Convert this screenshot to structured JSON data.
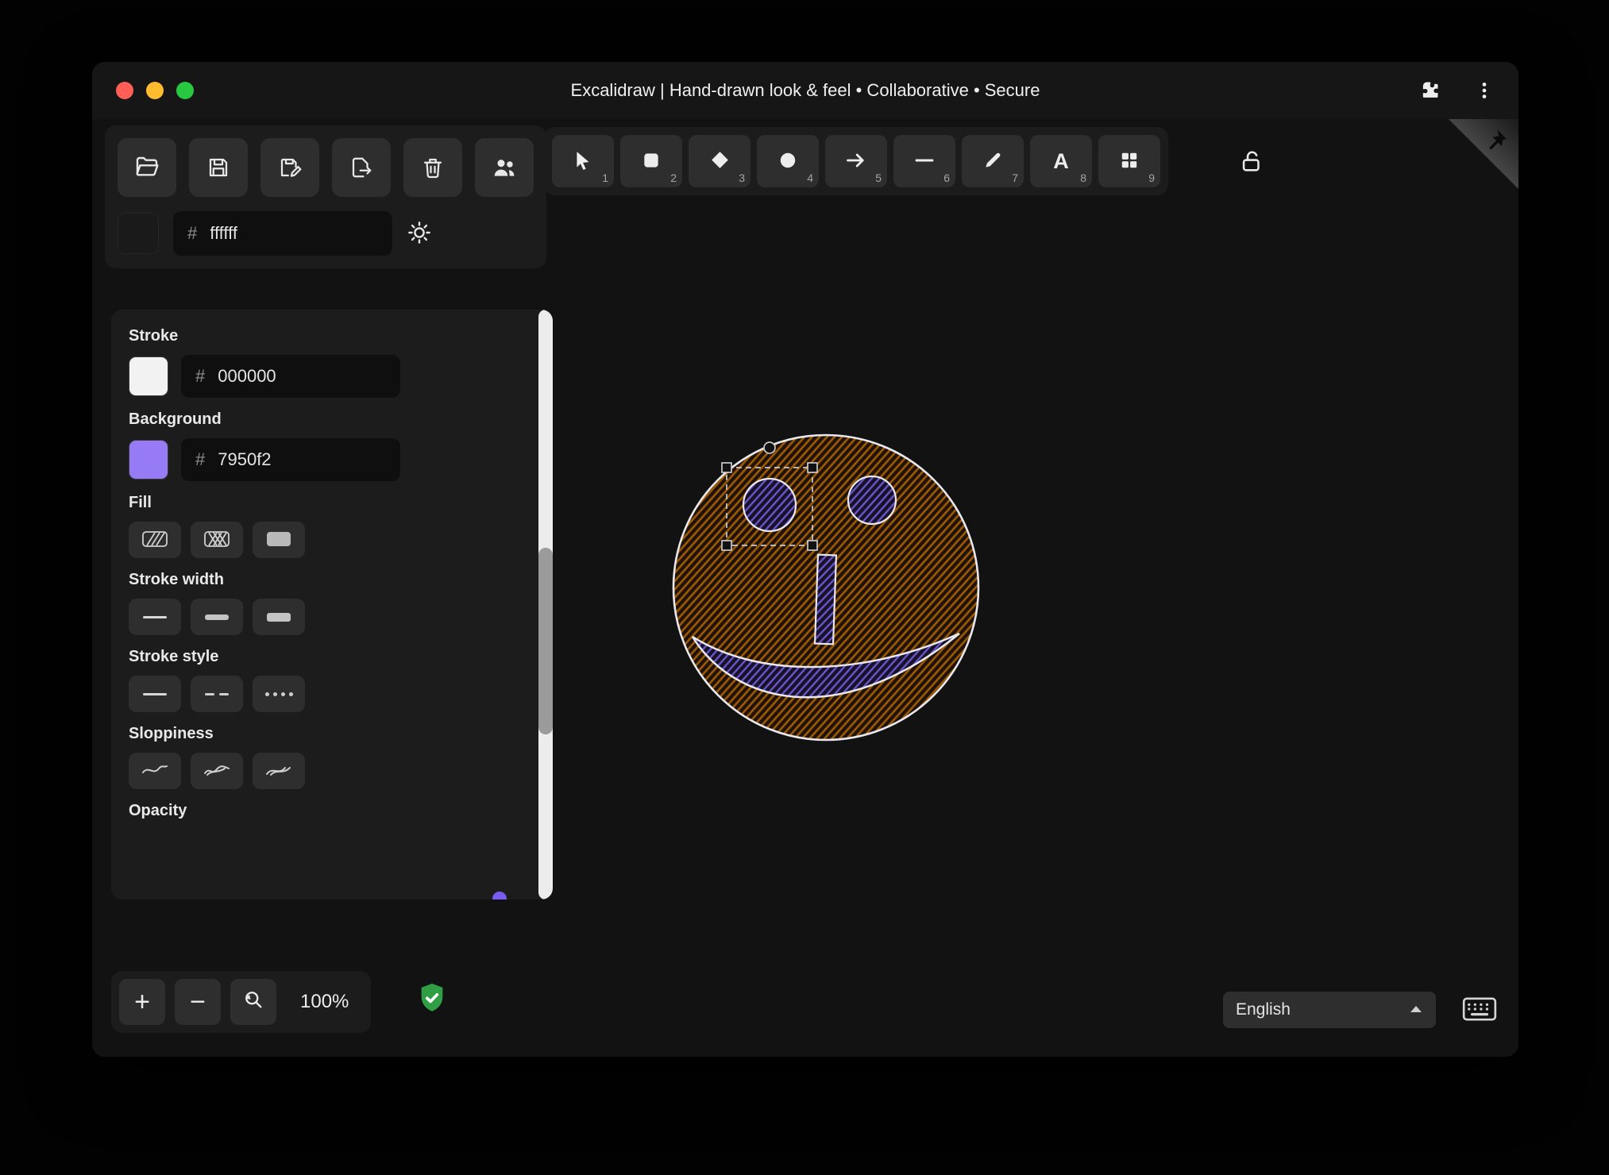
{
  "titlebar": {
    "title": "Excalidraw | Hand-drawn look & feel • Collaborative • Secure"
  },
  "file_toolbar": {
    "buttons": [
      "open-folder",
      "save",
      "save-as",
      "export-file",
      "trash",
      "collaborators"
    ]
  },
  "canvas_background": {
    "hash": "#",
    "value": "ffffff"
  },
  "tool_toolbar": {
    "tools": [
      {
        "name": "selection",
        "shortcut": "1"
      },
      {
        "name": "rectangle",
        "shortcut": "2"
      },
      {
        "name": "diamond",
        "shortcut": "3"
      },
      {
        "name": "ellipse",
        "shortcut": "4"
      },
      {
        "name": "arrow",
        "shortcut": "5"
      },
      {
        "name": "line",
        "shortcut": "6"
      },
      {
        "name": "draw",
        "shortcut": "7"
      },
      {
        "name": "text",
        "shortcut": "8",
        "glyph": "A"
      },
      {
        "name": "shapes",
        "shortcut": "9"
      }
    ],
    "lock": "keep-selected-tool-active"
  },
  "properties_panel": {
    "stroke": {
      "label": "Stroke",
      "hash": "#",
      "value": "000000",
      "swatch_color": "#f2f2f2"
    },
    "background": {
      "label": "Background",
      "hash": "#",
      "value": "7950f2",
      "swatch_color": "#977af5"
    },
    "fill": {
      "label": "Fill",
      "options": [
        "hachure",
        "cross-hatch",
        "solid"
      ]
    },
    "stroke_width": {
      "label": "Stroke width",
      "options": [
        "thin",
        "bold",
        "extra-bold"
      ]
    },
    "stroke_style": {
      "label": "Stroke style",
      "options": [
        "solid",
        "dashed",
        "dotted"
      ]
    },
    "sloppiness": {
      "label": "Sloppiness",
      "options": [
        "architect",
        "artist",
        "cartoonist"
      ]
    },
    "opacity": {
      "label": "Opacity"
    }
  },
  "footer": {
    "zoom_level": "100%",
    "language_select": {
      "value": "English"
    }
  },
  "colors": {
    "accent_purple": "#7950f2",
    "face_hachure": "#9a5a08",
    "shield_green": "#2f9e44",
    "canvas_bg": "#121212"
  }
}
